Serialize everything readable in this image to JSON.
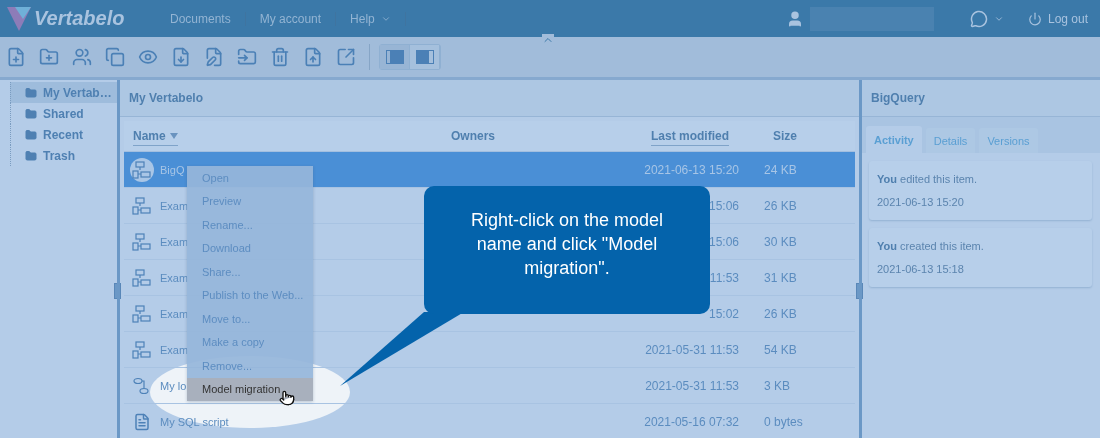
{
  "header": {
    "logo": "Vertabelo",
    "nav": [
      {
        "label": "Documents",
        "dropdown": false
      },
      {
        "label": "My account",
        "dropdown": false
      },
      {
        "label": "Help",
        "dropdown": true
      }
    ],
    "logout": "Log out"
  },
  "sidebar": {
    "items": [
      {
        "label": "My Vertab…",
        "selected": true
      },
      {
        "label": "Shared",
        "selected": false
      },
      {
        "label": "Recent",
        "selected": false
      },
      {
        "label": "Trash",
        "selected": false
      }
    ]
  },
  "toolbar": {
    "layout_toggles": [
      {
        "selected": true
      },
      {
        "selected": false
      }
    ]
  },
  "main": {
    "title": "My Vertabelo",
    "columns": [
      {
        "label": "Name",
        "sorted": true,
        "sortable": true
      },
      {
        "label": "Owners",
        "sorted": false,
        "sortable": false
      },
      {
        "label": "Last modified",
        "sorted": false,
        "sortable": true
      },
      {
        "label": "Size",
        "sorted": false,
        "sortable": false
      }
    ],
    "rows": [
      {
        "name": "BigQ",
        "kind": "model",
        "date": "2021-06-13 15:20",
        "size": "24 KB",
        "selected": true
      },
      {
        "name": "Exam",
        "kind": "model",
        "date": "15:06",
        "size": "26 KB",
        "selected": false
      },
      {
        "name": "Exam",
        "kind": "model",
        "date": "15:06",
        "size": "30 KB",
        "selected": false
      },
      {
        "name": "Exam",
        "kind": "model",
        "date": "11:53",
        "size": "31 KB",
        "selected": false
      },
      {
        "name": "Exam",
        "kind": "model",
        "date": "15:02",
        "size": "26 KB",
        "selected": false
      },
      {
        "name": "Exam",
        "kind": "model",
        "date": "2021-05-31 11:53",
        "size": "54 KB",
        "selected": false
      },
      {
        "name": "My lo",
        "kind": "logical",
        "date": "2021-05-31 11:53",
        "size": "3 KB",
        "selected": false
      },
      {
        "name": "My SQL script",
        "kind": "script",
        "date": "2021-05-16 07:32",
        "size": "0 bytes",
        "selected": false
      }
    ]
  },
  "context_menu": {
    "items": [
      {
        "label": "Open",
        "hovered": false
      },
      {
        "label": "Preview",
        "hovered": false
      },
      {
        "label": "Rename...",
        "hovered": false
      },
      {
        "label": "Download",
        "hovered": false
      },
      {
        "label": "Share...",
        "hovered": false
      },
      {
        "label": "Publish to the Web...",
        "hovered": false
      },
      {
        "label": "Move to...",
        "hovered": false
      },
      {
        "label": "Make a copy",
        "hovered": false
      },
      {
        "label": "Remove...",
        "hovered": false
      },
      {
        "label": "Model migration",
        "hovered": true
      }
    ]
  },
  "details": {
    "title": "BigQuery",
    "tabs": [
      {
        "label": "Activity",
        "selected": true
      },
      {
        "label": "Details",
        "selected": false
      },
      {
        "label": "Versions",
        "selected": false
      }
    ],
    "activity": [
      {
        "text": "**You** edited this item.",
        "time": "2021-06-13 15:20"
      },
      {
        "text": "**You** created this item.",
        "time": "2021-06-13 15:18"
      }
    ]
  },
  "callout": {
    "text": "Right-click on the model name and click \"Model migration\"."
  }
}
